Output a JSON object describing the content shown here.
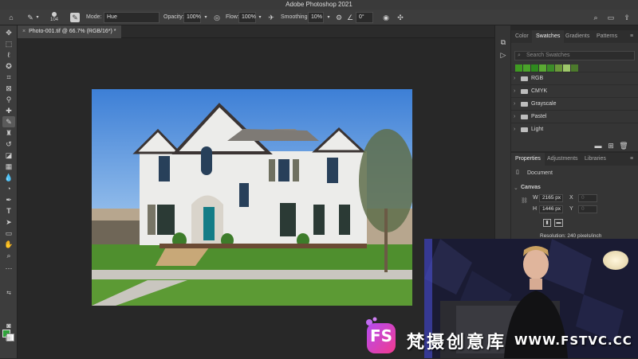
{
  "title": "Adobe Photoshop 2021",
  "options": {
    "brush_size": "104",
    "mode_label": "Mode:",
    "mode_value": "Hue",
    "opacity_label": "Opacity:",
    "opacity_value": "100%",
    "flow_label": "Flow:",
    "flow_value": "100%",
    "smoothing_label": "Smoothing:",
    "smoothing_value": "10%",
    "angle_value": "0°"
  },
  "document_tab": "Photo-001.tif @ 66.7% (RGB/16*) *",
  "tools": [
    "move-tool",
    "marquee-tool",
    "lasso-tool",
    "quick-select-tool",
    "crop-tool",
    "frame-tool",
    "eyedropper-tool",
    "healing-brush-tool",
    "brush-tool",
    "clone-stamp-tool",
    "history-brush-tool",
    "eraser-tool",
    "gradient-tool",
    "blur-tool",
    "dodge-tool",
    "pen-tool",
    "type-tool",
    "path-select-tool",
    "shape-tool",
    "hand-tool",
    "zoom-tool",
    "more-tools"
  ],
  "colors": {
    "foreground": "#2fa33a",
    "background": "#ffffff",
    "accent": "#3d3d3d"
  },
  "swatches_panel": {
    "tabs": [
      "Color",
      "Swatches",
      "Gradients",
      "Patterns"
    ],
    "active_tab": "Swatches",
    "search_placeholder": "Search Swatches",
    "recent_colors": [
      "#3f9a22",
      "#4aa32a",
      "#2f8a1e",
      "#5aaa33",
      "#3c8c28",
      "#6b9a3a",
      "#9ec86a",
      "#4c7a2c"
    ],
    "groups": [
      "RGB",
      "CMYK",
      "Grayscale",
      "Pastel",
      "Light"
    ]
  },
  "properties_panel": {
    "tabs": [
      "Properties",
      "Adjustments",
      "Libraries"
    ],
    "active_tab": "Properties",
    "kind": "Document",
    "section": "Canvas",
    "w_label": "W",
    "w_value": "2165 px",
    "h_label": "H",
    "h_value": "1446 px",
    "x_label": "X",
    "x_value": "0",
    "y_label": "Y",
    "y_value": "0",
    "resolution": "Resolution: 240 pixels/inch"
  },
  "watermark": {
    "logo_text": "FS",
    "text": "梵摄创意库",
    "url": "WWW.FSTVC.CC"
  }
}
